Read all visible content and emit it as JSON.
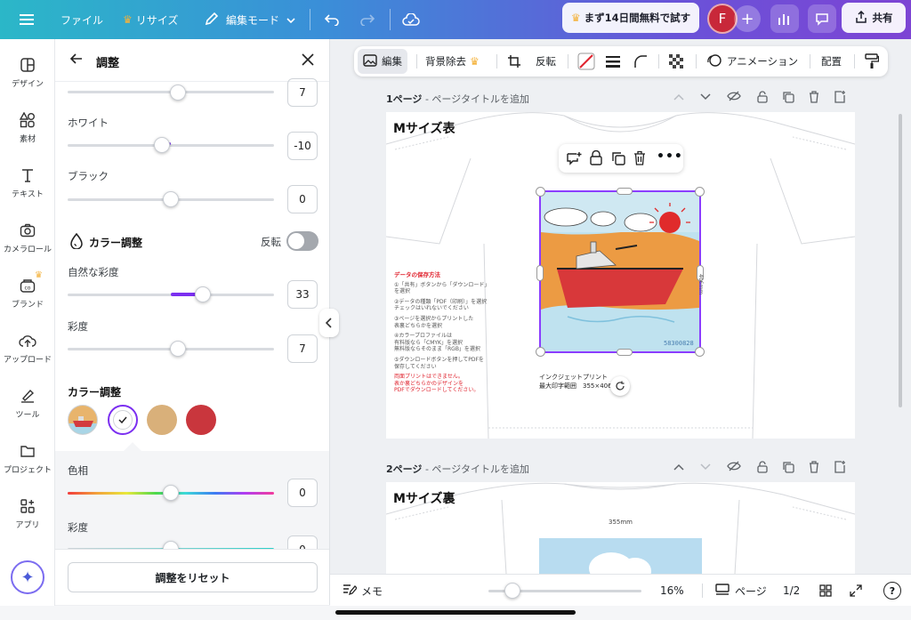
{
  "topbar": {
    "file": "ファイル",
    "resize": "リサイズ",
    "edit_mode": "編集モード",
    "trial": "まず14日間無料で試す",
    "avatar": "F",
    "share": "共有"
  },
  "rail": [
    {
      "label": "デザイン",
      "icon": "design-icon"
    },
    {
      "label": "素材",
      "icon": "elements-icon"
    },
    {
      "label": "テキスト",
      "icon": "text-icon"
    },
    {
      "label": "カメラロール",
      "icon": "camera-icon"
    },
    {
      "label": "ブランド",
      "icon": "brand-icon"
    },
    {
      "label": "アップロード",
      "icon": "upload-icon"
    },
    {
      "label": "ツール",
      "icon": "tools-icon"
    },
    {
      "label": "プロジェクト",
      "icon": "folder-icon"
    },
    {
      "label": "アプリ",
      "icon": "apps-icon"
    }
  ],
  "panel": {
    "title": "調整",
    "top_value": "7",
    "white_label": "ホワイト",
    "white_value": "-10",
    "black_label": "ブラック",
    "black_value": "0",
    "color_adjust_label": "カラー調整",
    "invert_label": "反転",
    "natural_sat_label": "自然な彩度",
    "natural_sat_value": "33",
    "saturation_label": "彩度",
    "saturation_value": "7",
    "color_section_title": "カラー調整",
    "swatch_colors": [
      "#ffffff",
      "#d9b07a",
      "#c9363d"
    ],
    "hue_label": "色相",
    "hue_value": "0",
    "sat2_label": "彩度",
    "sat2_value": "0",
    "reset": "調整をリセット"
  },
  "ctx": {
    "edit": "編集",
    "bg_remove": "背景除去",
    "flip": "反転",
    "animation": "アニメーション",
    "arrange": "配置"
  },
  "page1": {
    "num": "1ページ",
    "title_placeholder": "- ページタイトルを追加",
    "label": "Mサイズ表",
    "side_dim": "406mm",
    "stamp": "58300828",
    "print_label": "インクジェットプリント",
    "print_range": "最大印字範囲　355×406",
    "notes_title": "データの保存方法",
    "notes": [
      "①「共有」ボタンから「ダウンロード」",
      "を選択",
      "②データの種類「PDF（印刷）」を選択",
      "チェックはいれないでください",
      "③ページを選択からプリントした",
      "表裏どちらかを選択",
      "④カラープロファイルは",
      "有料版なら「CMYK」を選択",
      "無料版ならそのまま「RGB」を選択",
      "⑤ダウンロードボタンを押してPDFを",
      "保存してください"
    ],
    "notes_warning": [
      "両面プリントはできません。",
      "表か裏どちらかのデザインを",
      "PDFでダウンロードしてください。"
    ]
  },
  "page2": {
    "num": "2ページ",
    "title_placeholder": "- ページタイトルを追加",
    "label": "Mサイズ裏",
    "top_dim": "355mm"
  },
  "bottom": {
    "notes": "メモ",
    "zoom_value": 16,
    "zoom": "16%",
    "pages": "ページ",
    "page_count": "1/2",
    "help": "?"
  }
}
